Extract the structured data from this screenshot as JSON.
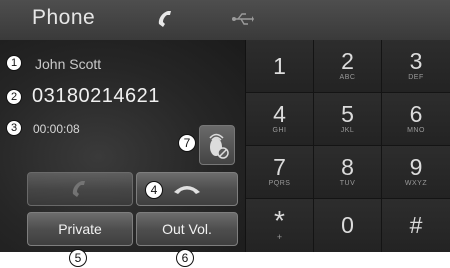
{
  "statusbar": {
    "title": "Phone",
    "call_icon": "handset-icon",
    "usb_icon": "usb-icon"
  },
  "call": {
    "name": "John Scott",
    "number": "03180214621",
    "duration": "00:00:08"
  },
  "controls": {
    "accept_icon": "handset-icon",
    "end_icon": "end-call-icon",
    "private_label": "Private",
    "out_vol_label": "Out Vol.",
    "privacy_icon": "hidden-caller-icon"
  },
  "keypad": [
    {
      "digit": "1",
      "letters": ""
    },
    {
      "digit": "2",
      "letters": "ABC"
    },
    {
      "digit": "3",
      "letters": "DEF"
    },
    {
      "digit": "4",
      "letters": "GHI"
    },
    {
      "digit": "5",
      "letters": "JKL"
    },
    {
      "digit": "6",
      "letters": "MNO"
    },
    {
      "digit": "7",
      "letters": "PQRS"
    },
    {
      "digit": "8",
      "letters": "TUV"
    },
    {
      "digit": "9",
      "letters": "WXYZ"
    },
    {
      "digit": "*",
      "letters": "+"
    },
    {
      "digit": "0",
      "letters": ""
    },
    {
      "digit": "#",
      "letters": ""
    }
  ],
  "callouts": [
    "1",
    "2",
    "3",
    "4",
    "5",
    "6",
    "7"
  ],
  "colors": {
    "background": "#2b2b2b",
    "text": "#dcdcdc",
    "button": "#4e4e4e"
  }
}
